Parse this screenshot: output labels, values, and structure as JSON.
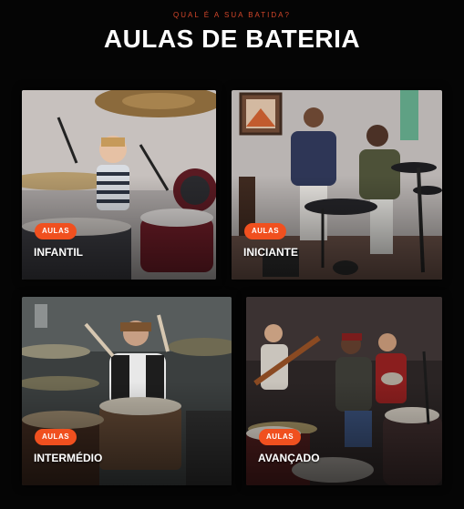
{
  "header": {
    "kicker": "QUAL É A SUA BATIDA?",
    "title": "AULAS DE BATERIA"
  },
  "cards": [
    {
      "badge": "AULAS",
      "label": "INFANTIL"
    },
    {
      "badge": "AULAS",
      "label": "INICIANTE"
    },
    {
      "badge": "AULAS",
      "label": "INTERMÉDIO"
    },
    {
      "badge": "AULAS",
      "label": "AVANÇADO"
    }
  ],
  "colors": {
    "background": "#050505",
    "accent": "#f0501f",
    "kicker": "#d2462a"
  }
}
